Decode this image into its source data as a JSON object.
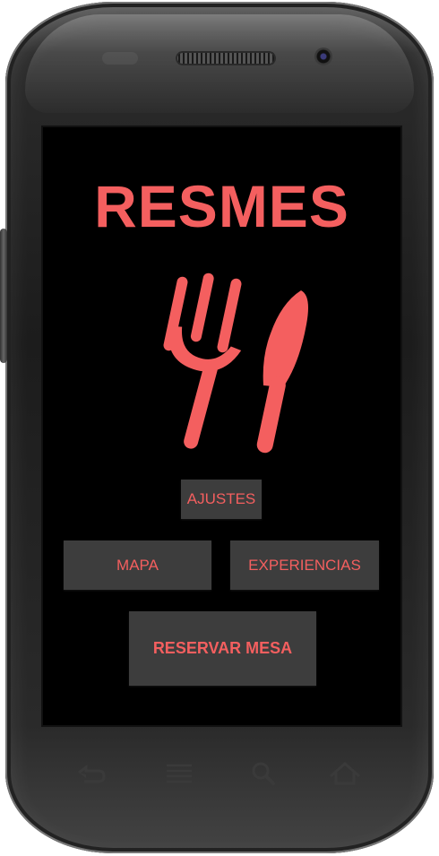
{
  "app": {
    "title": "RESMES",
    "logo_icon": "fork-knife-icon",
    "accent_color": "#f45f5f"
  },
  "buttons": {
    "settings": "AJUSTES",
    "map": "MAPA",
    "experiences": "EXPERIENCIAS",
    "reserve": "RESERVAR MESA"
  },
  "device": {
    "nav_keys": [
      "back-icon",
      "menu-icon",
      "search-icon",
      "home-icon"
    ]
  }
}
